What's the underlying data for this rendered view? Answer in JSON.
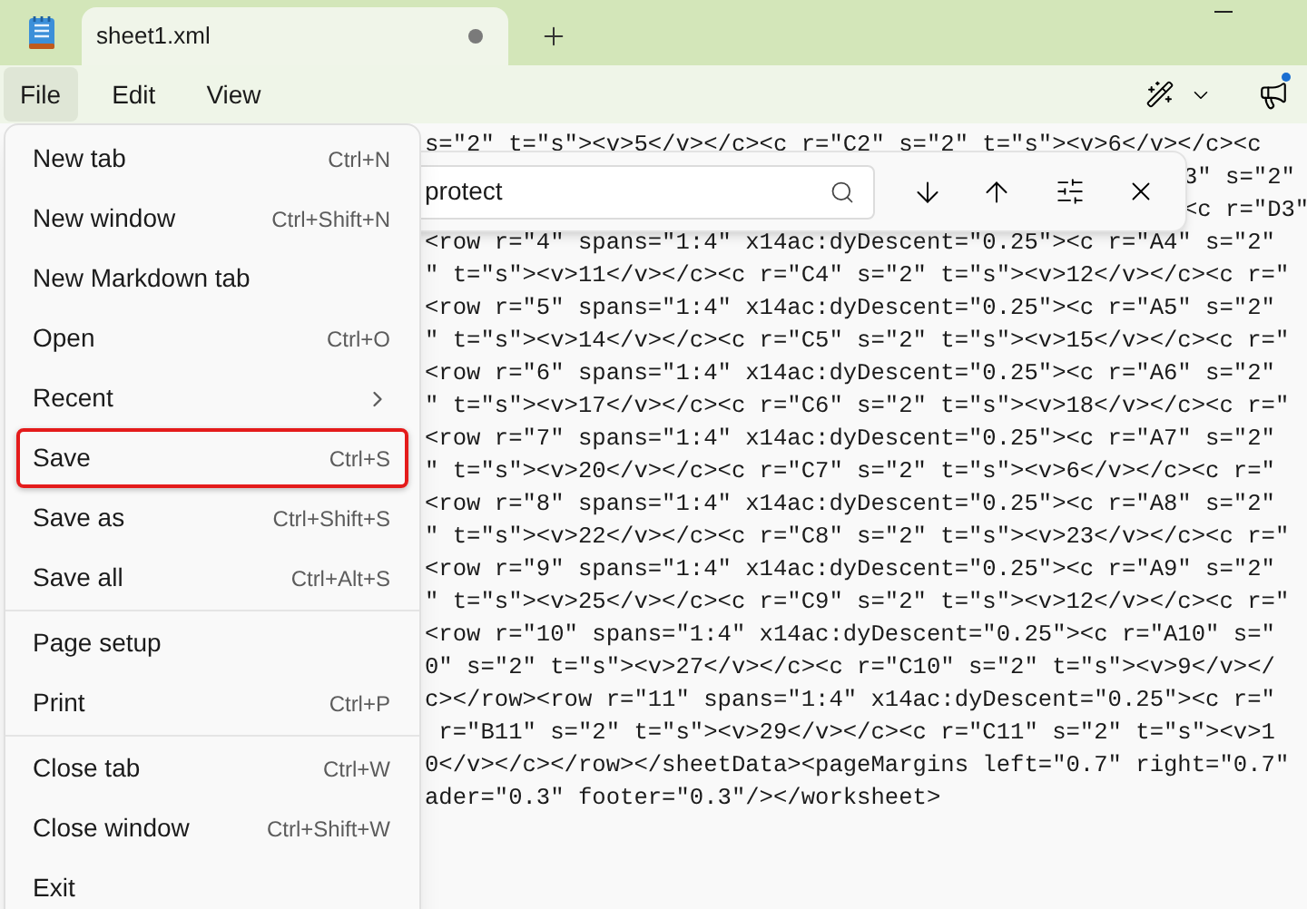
{
  "window": {
    "tab_title": "sheet1.xml",
    "tab_unsaved": true
  },
  "menu_bar": [
    {
      "label": "File",
      "selected": true
    },
    {
      "label": "Edit",
      "selected": false
    },
    {
      "label": "View",
      "selected": false
    }
  ],
  "find_bar": {
    "value": "protect"
  },
  "editor": {
    "lines": [
      {
        "kind": "full",
        "text": "s=\"2\" t=\"s\"><v>5</v></c><c r=\"C2\" s=\"2\" t=\"s\"><v>6</v></c><c"
      },
      {
        "kind": "behind_find_bar",
        "text": "3\" s=\"2\""
      },
      {
        "kind": "behind_find_bar",
        "text": "<c r=\"D3\""
      },
      {
        "kind": "full",
        "text": "<row r=\"4\" spans=\"1:4\" x14ac:dyDescent=\"0.25\"><c r=\"A4\" s=\"2\""
      },
      {
        "kind": "full",
        "text": "\" t=\"s\"><v>11</v></c><c r=\"C4\" s=\"2\" t=\"s\"><v>12</v></c><c r=\""
      },
      {
        "kind": "full",
        "text": "<row r=\"5\" spans=\"1:4\" x14ac:dyDescent=\"0.25\"><c r=\"A5\" s=\"2\""
      },
      {
        "kind": "full",
        "text": "\" t=\"s\"><v>14</v></c><c r=\"C5\" s=\"2\" t=\"s\"><v>15</v></c><c r=\""
      },
      {
        "kind": "full",
        "text": "<row r=\"6\" spans=\"1:4\" x14ac:dyDescent=\"0.25\"><c r=\"A6\" s=\"2\""
      },
      {
        "kind": "full",
        "text": "\" t=\"s\"><v>17</v></c><c r=\"C6\" s=\"2\" t=\"s\"><v>18</v></c><c r=\""
      },
      {
        "kind": "full",
        "text": "<row r=\"7\" spans=\"1:4\" x14ac:dyDescent=\"0.25\"><c r=\"A7\" s=\"2\""
      },
      {
        "kind": "full",
        "text": "\" t=\"s\"><v>20</v></c><c r=\"C7\" s=\"2\" t=\"s\"><v>6</v></c><c r=\""
      },
      {
        "kind": "full",
        "text": "<row r=\"8\" spans=\"1:4\" x14ac:dyDescent=\"0.25\"><c r=\"A8\" s=\"2\""
      },
      {
        "kind": "full",
        "text": "\" t=\"s\"><v>22</v></c><c r=\"C8\" s=\"2\" t=\"s\"><v>23</v></c><c r=\""
      },
      {
        "kind": "full",
        "text": "<row r=\"9\" spans=\"1:4\" x14ac:dyDescent=\"0.25\"><c r=\"A9\" s=\"2\""
      },
      {
        "kind": "full",
        "text": "\" t=\"s\"><v>25</v></c><c r=\"C9\" s=\"2\" t=\"s\"><v>12</v></c><c r=\""
      },
      {
        "kind": "full",
        "text": "<row r=\"10\" spans=\"1:4\" x14ac:dyDescent=\"0.25\"><c r=\"A10\" s=\""
      },
      {
        "kind": "full",
        "text": "0\" s=\"2\" t=\"s\"><v>27</v></c><c r=\"C10\" s=\"2\" t=\"s\"><v>9</v></"
      },
      {
        "kind": "full",
        "text": "c></row><row r=\"11\" spans=\"1:4\" x14ac:dyDescent=\"0.25\"><c r=\""
      },
      {
        "kind": "full",
        "text": " r=\"B11\" s=\"2\" t=\"s\"><v>29</v></c><c r=\"C11\" s=\"2\" t=\"s\"><v>1"
      },
      {
        "kind": "full",
        "text": "0</v></c></row></sheetData><pageMargins left=\"0.7\" right=\"0.7\""
      },
      {
        "kind": "full",
        "text": "ader=\"0.3\" footer=\"0.3\"/></worksheet>"
      }
    ]
  },
  "file_menu": {
    "groups": [
      [
        {
          "label": "New tab",
          "shortcut": "Ctrl+N",
          "has_submenu": false,
          "selected": false
        },
        {
          "label": "New window",
          "shortcut": "Ctrl+Shift+N",
          "has_submenu": false,
          "selected": false
        },
        {
          "label": "New Markdown tab",
          "has_submenu": false,
          "selected": false
        },
        {
          "label": "Open",
          "shortcut": "Ctrl+O",
          "has_submenu": false,
          "selected": false
        },
        {
          "label": "Recent",
          "has_submenu": true,
          "selected": false
        },
        {
          "label": "Save",
          "shortcut": "Ctrl+S",
          "has_submenu": false,
          "selected": true
        },
        {
          "label": "Save as",
          "shortcut": "Ctrl+Shift+S",
          "has_submenu": false,
          "selected": false
        },
        {
          "label": "Save all",
          "shortcut": "Ctrl+Alt+S",
          "has_submenu": false,
          "selected": false
        }
      ],
      [
        {
          "label": "Page setup",
          "has_submenu": false,
          "selected": false
        },
        {
          "label": "Print",
          "shortcut": "Ctrl+P",
          "has_submenu": false,
          "selected": false
        }
      ],
      [
        {
          "label": "Close tab",
          "shortcut": "Ctrl+W",
          "has_submenu": false,
          "selected": false
        },
        {
          "label": "Close window",
          "shortcut": "Ctrl+Shift+W",
          "has_submenu": false,
          "selected": false
        },
        {
          "label": "Exit",
          "has_submenu": false,
          "selected": false
        }
      ]
    ]
  }
}
